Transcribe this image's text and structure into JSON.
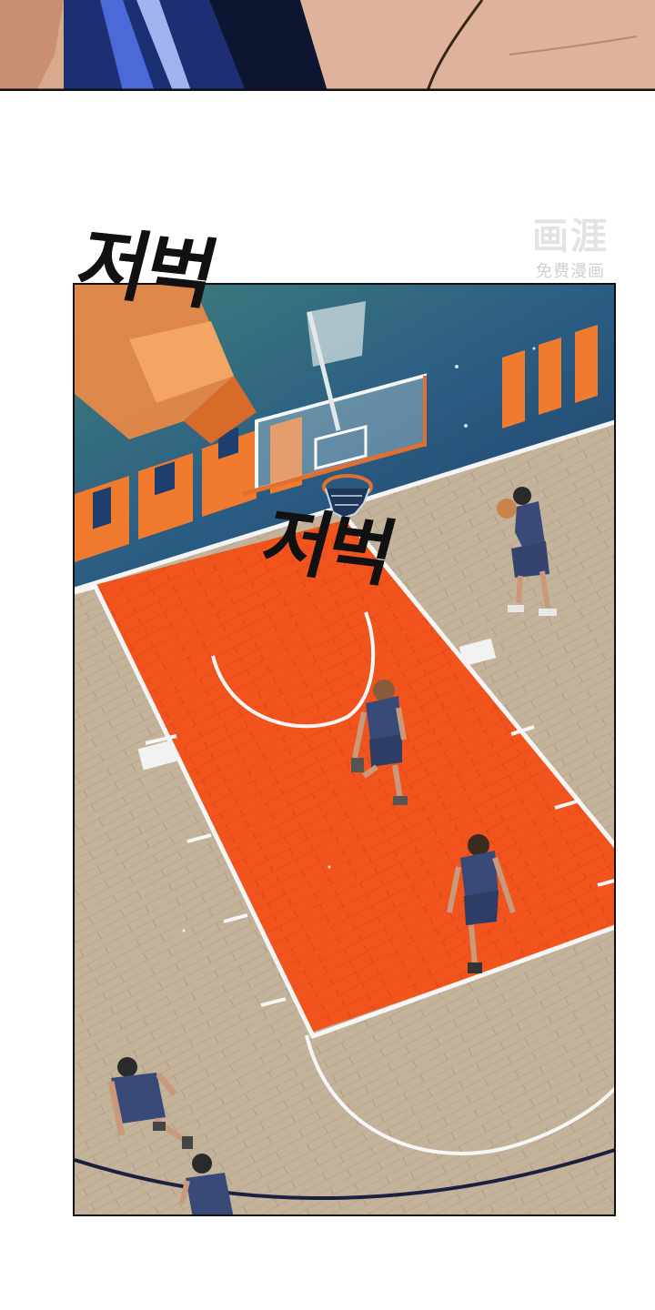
{
  "sound_effects": {
    "upper": "저벅",
    "lower": "저벅"
  },
  "watermark": {
    "title": "画涯",
    "subtitle": "免费漫画"
  },
  "colors": {
    "paint": "#f2521c",
    "hardwood": "#bfae97",
    "baseline_blue": "#1e3f6e",
    "banner_orange": "#f07a2e",
    "jersey": "#3a4a78",
    "panel_border": "#111111"
  }
}
